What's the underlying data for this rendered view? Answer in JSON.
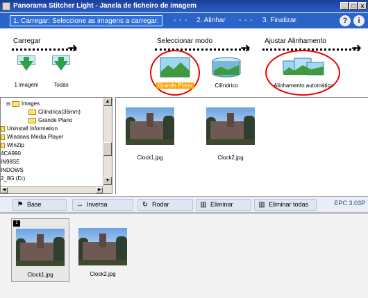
{
  "window": {
    "title": "Panorama Stitcher Light - Janela de ficheiro de imagem",
    "btn_min": "_",
    "btn_max": "□",
    "btn_close": "x"
  },
  "steps": {
    "step1": "1. Carregar: Seleccione as imagens a carregar.",
    "step2": "2. Alinhar",
    "step3": "3. Finalizar",
    "sep": "- - -",
    "help": "?",
    "exit": "i"
  },
  "sections": {
    "load": "Carregar",
    "mode": "Seleccionar modo",
    "align": "Ajustar Alinhamento"
  },
  "load_buttons": {
    "one": "1 imagem",
    "all": "Todas"
  },
  "mode_buttons": {
    "wide": "Grande Plano",
    "cyl": "Cilíndrico"
  },
  "align_button": {
    "auto": "Alinhamento automático"
  },
  "tree": {
    "items": [
      "Images",
      "Cilíndrica(36mm)",
      "Grande Plano",
      "Uninstall Information",
      "Windows Media Player",
      "WinZip",
      "4CA990",
      "IN98SE",
      "INDOWS",
      "2_8G (D:)"
    ]
  },
  "preview": {
    "files": [
      "Clock1.jpg",
      "Clock2.jpg"
    ]
  },
  "toolbar": {
    "base": "Base",
    "inverse": "Inversa",
    "rotate": "Rodar",
    "delete": "Eliminar",
    "delete_all": "Eliminar todas",
    "epc": "EPC 3.03P"
  },
  "strip": {
    "files": [
      "Clock1.jpg",
      "Clock2.jpg"
    ],
    "flag": "1"
  }
}
